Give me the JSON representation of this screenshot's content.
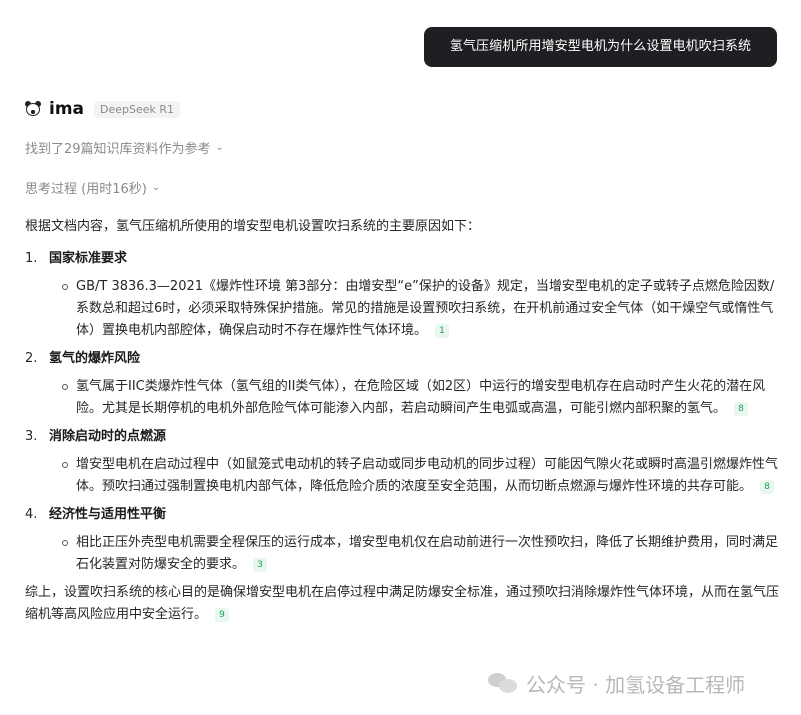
{
  "user_message": "氢气压缩机所用增安型电机为什么设置电机吹扫系统",
  "assistant": {
    "name": "ima",
    "model": "DeepSeek R1",
    "references_text": "找到了29篇知识库资料作为参考",
    "thinking_text": "思考过程 (用时16秒)"
  },
  "answer": {
    "intro": "根据文档内容，氢气压缩机所使用的增安型电机设置吹扫系统的主要原因如下：",
    "sections": [
      {
        "num": "1.",
        "title": "国家标准要求",
        "bullet": "GB/T 3836.3—2021《爆炸性环境 第3部分：由增安型“e”保护的设备》规定，当增安型电机的定子或转子点燃危险因数/系数总和超过6时，必须采取特殊保护措施。常见的措施是设置预吹扫系统，在开机前通过安全气体（如干燥空气或惰性气体）置换电机内部腔体，确保启动时不存在爆炸性气体环境。",
        "cite": "1"
      },
      {
        "num": "2.",
        "title": "氢气的爆炸风险",
        "bullet": "氢气属于IIC类爆炸性气体（氢气组的II类气体），在危险区域（如2区）中运行的增安型电机存在启动时产生火花的潜在风险。尤其是长期停机的电机外部危险气体可能渗入内部，若启动瞬间产生电弧或高温，可能引燃内部积聚的氢气。",
        "cite": "8"
      },
      {
        "num": "3.",
        "title": "消除启动时的点燃源",
        "bullet": "增安型电机在启动过程中（如鼠笼式电动机的转子启动或同步电动机的同步过程）可能因气隙火花或瞬时高温引燃爆炸性气体。预吹扫通过强制置换电机内部气体，降低危险介质的浓度至安全范围，从而切断点燃源与爆炸性环境的共存可能。",
        "cite": "8"
      },
      {
        "num": "4.",
        "title": "经济性与适用性平衡",
        "bullet": "相比正压外壳型电机需要全程保压的运行成本，增安型电机仅在启动前进行一次性预吹扫，降低了长期维护费用，同时满足石化装置对防爆安全的要求。",
        "cite": "3"
      }
    ],
    "conclusion": "综上，设置吹扫系统的核心目的是确保增安型电机在启停过程中满足防爆安全标准，通过预吹扫消除爆炸性气体环境，从而在氢气压缩机等高风险应用中安全运行。",
    "conclusion_cite": "9"
  },
  "watermark": "公众号 · 加氢设备工程师",
  "colors": {
    "bubble_bg": "#1e1f22",
    "cite_bg": "#e9f7ef",
    "cite_fg": "#18a058",
    "muted": "#8a8a8a"
  },
  "icons": {
    "avatar": "panda-icon",
    "expand": "chevron-down-icon",
    "watermark": "wechat-icon"
  }
}
